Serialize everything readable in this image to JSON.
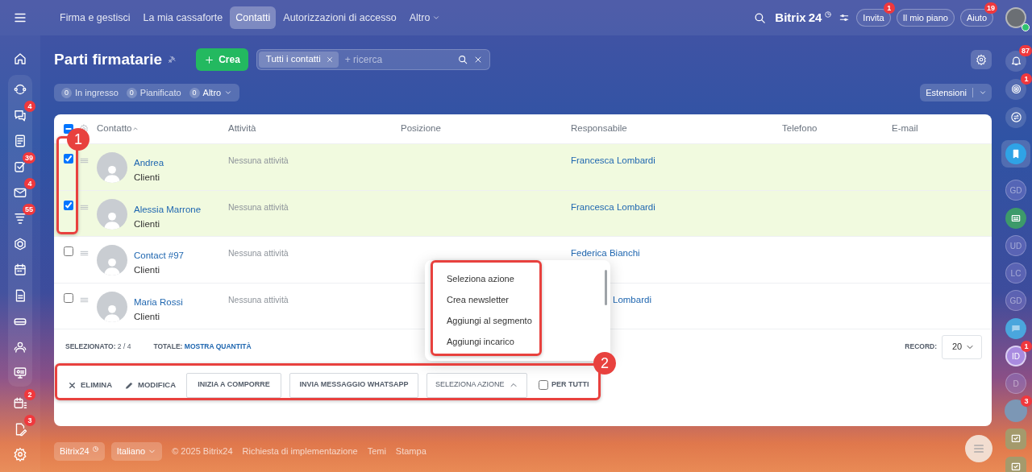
{
  "top_nav": {
    "items": [
      {
        "label": "Firma e gestisci",
        "selected": false,
        "has_menu": false
      },
      {
        "label": "La mia cassaforte",
        "selected": false,
        "has_menu": false
      },
      {
        "label": "Contatti",
        "selected": true,
        "has_menu": false
      },
      {
        "label": "Autorizzazioni di accesso",
        "selected": false,
        "has_menu": false
      },
      {
        "label": "Altro",
        "selected": false,
        "has_menu": true
      }
    ]
  },
  "header": {
    "brand_name": "Bitrix",
    "brand_number": "24",
    "buttons": [
      {
        "label": "Invita",
        "badge": "1"
      },
      {
        "label": "Il mio piano"
      },
      {
        "label": "Aiuto",
        "badge": "19"
      }
    ]
  },
  "left_sidebar": {
    "items": [
      {
        "in_group": false
      },
      {
        "in_group": true
      },
      {
        "in_group": true,
        "badge": "4"
      },
      {
        "in_group": true
      },
      {
        "in_group": true,
        "badge": "39"
      },
      {
        "in_group": true,
        "badge": "4"
      },
      {
        "in_group": true,
        "badge": "55"
      },
      {
        "in_group": true
      },
      {
        "in_group": true
      },
      {
        "in_group": true
      },
      {
        "in_group": true
      },
      {
        "in_group": true
      },
      {
        "in_group": true
      },
      {
        "in_group": false,
        "badge": "2"
      },
      {
        "in_group": false,
        "badge": "3"
      }
    ]
  },
  "toolbar": {
    "title": "Parti firmatarie",
    "create_button": "Crea",
    "filter": {
      "tag": "Tutti i contatti",
      "placeholder": "+ ricerca"
    },
    "counters": [
      {
        "count": "0",
        "label": "In ingresso",
        "has_menu": false
      },
      {
        "count": "0",
        "label": "Pianificato",
        "has_menu": false
      },
      {
        "count": "0",
        "label": "Altro",
        "has_menu": true
      }
    ],
    "extensions_button": "Estensioni"
  },
  "table": {
    "select_all_indeterminate": true,
    "columns": [
      {
        "label": "Contatto",
        "sorted": true
      },
      {
        "label": "Attività",
        "sorted": false
      },
      {
        "label": "Posizione",
        "sorted": false
      },
      {
        "label": "Responsabile",
        "sorted": false
      },
      {
        "label": "Telefono",
        "sorted": false
      },
      {
        "label": "E-mail",
        "sorted": false
      }
    ],
    "rows": [
      {
        "checked": true,
        "name": "Andrea",
        "type": "Clienti",
        "activity": "Nessuna attività",
        "responsible": "Francesca Lombardi",
        "responsible_partly_covered": false
      },
      {
        "checked": true,
        "name": "Alessia Marrone",
        "type": "Clienti",
        "activity": "Nessuna attività",
        "responsible": "Francesca Lombardi",
        "responsible_partly_covered": false
      },
      {
        "checked": false,
        "name": "Contact #97",
        "type": "Clienti",
        "activity": "Nessuna attività",
        "responsible": "Federica Bianchi",
        "responsible_partly_covered": false
      },
      {
        "checked": false,
        "name": "Maria Rossi",
        "type": "Clienti",
        "activity": "Nessuna attività",
        "responsible": "Lombardi",
        "responsible_partly_covered": true
      }
    ],
    "summary": {
      "selected_label": "SELEZIONATO:",
      "selected_value": "2 / 4",
      "total_label": "TOTALE:",
      "total_link": "MOSTRA QUANTITÀ",
      "record_label": "RECORD:",
      "record_value": "20"
    }
  },
  "action_bar": {
    "buttons": [
      {
        "kind": "link",
        "label": "ELIMINA"
      },
      {
        "kind": "link",
        "label": "MODIFICA"
      },
      {
        "kind": "outline",
        "label": "INIZIA A COMPORRE"
      },
      {
        "kind": "outline",
        "label": "INVIA MESSAGGIO WHATSAPP"
      },
      {
        "kind": "select",
        "label": "SELEZIONA AZIONE",
        "expanded": true
      }
    ],
    "for_all": {
      "label": "PER TUTTI",
      "checked": false
    }
  },
  "action_menu": {
    "items": [
      {
        "label": "Seleziona azione"
      },
      {
        "label": "Crea newsletter"
      },
      {
        "label": "Aggiungi al segmento"
      },
      {
        "label": "Aggiungi incarico"
      }
    ]
  },
  "annotations": [
    {
      "label": "1"
    },
    {
      "label": "2"
    }
  ],
  "footer": {
    "brand": "Bitrix24",
    "language": "Italiano",
    "copyright": "© 2025 Bitrix24",
    "links": [
      {
        "label": "Richiesta di implementazione"
      },
      {
        "label": "Temi"
      },
      {
        "label": "Stampa"
      }
    ]
  },
  "right_sidebar": {
    "items": [
      {
        "kind": "icon",
        "badge": "87",
        "selected": false
      },
      {
        "kind": "icon",
        "badge": "1",
        "selected": false
      },
      {
        "kind": "icon",
        "selected": false
      },
      {
        "kind": "icon",
        "selected": true
      },
      {
        "kind": "initials",
        "initials": "GD",
        "selected": false
      },
      {
        "kind": "icon",
        "selected": false
      },
      {
        "kind": "initials",
        "initials": "UD",
        "selected": false
      },
      {
        "kind": "initials",
        "initials": "LC",
        "selected": false
      },
      {
        "kind": "initials",
        "initials": "GD",
        "selected": false
      },
      {
        "kind": "icon",
        "selected": false
      },
      {
        "kind": "initials",
        "initials": "ID",
        "badge": "1",
        "selected": false
      },
      {
        "kind": "initials",
        "initials": "D",
        "selected": false
      },
      {
        "kind": "photo",
        "badge": "3",
        "selected": false
      },
      {
        "kind": "icon",
        "selected": false
      },
      {
        "kind": "icon",
        "selected": false
      }
    ]
  }
}
